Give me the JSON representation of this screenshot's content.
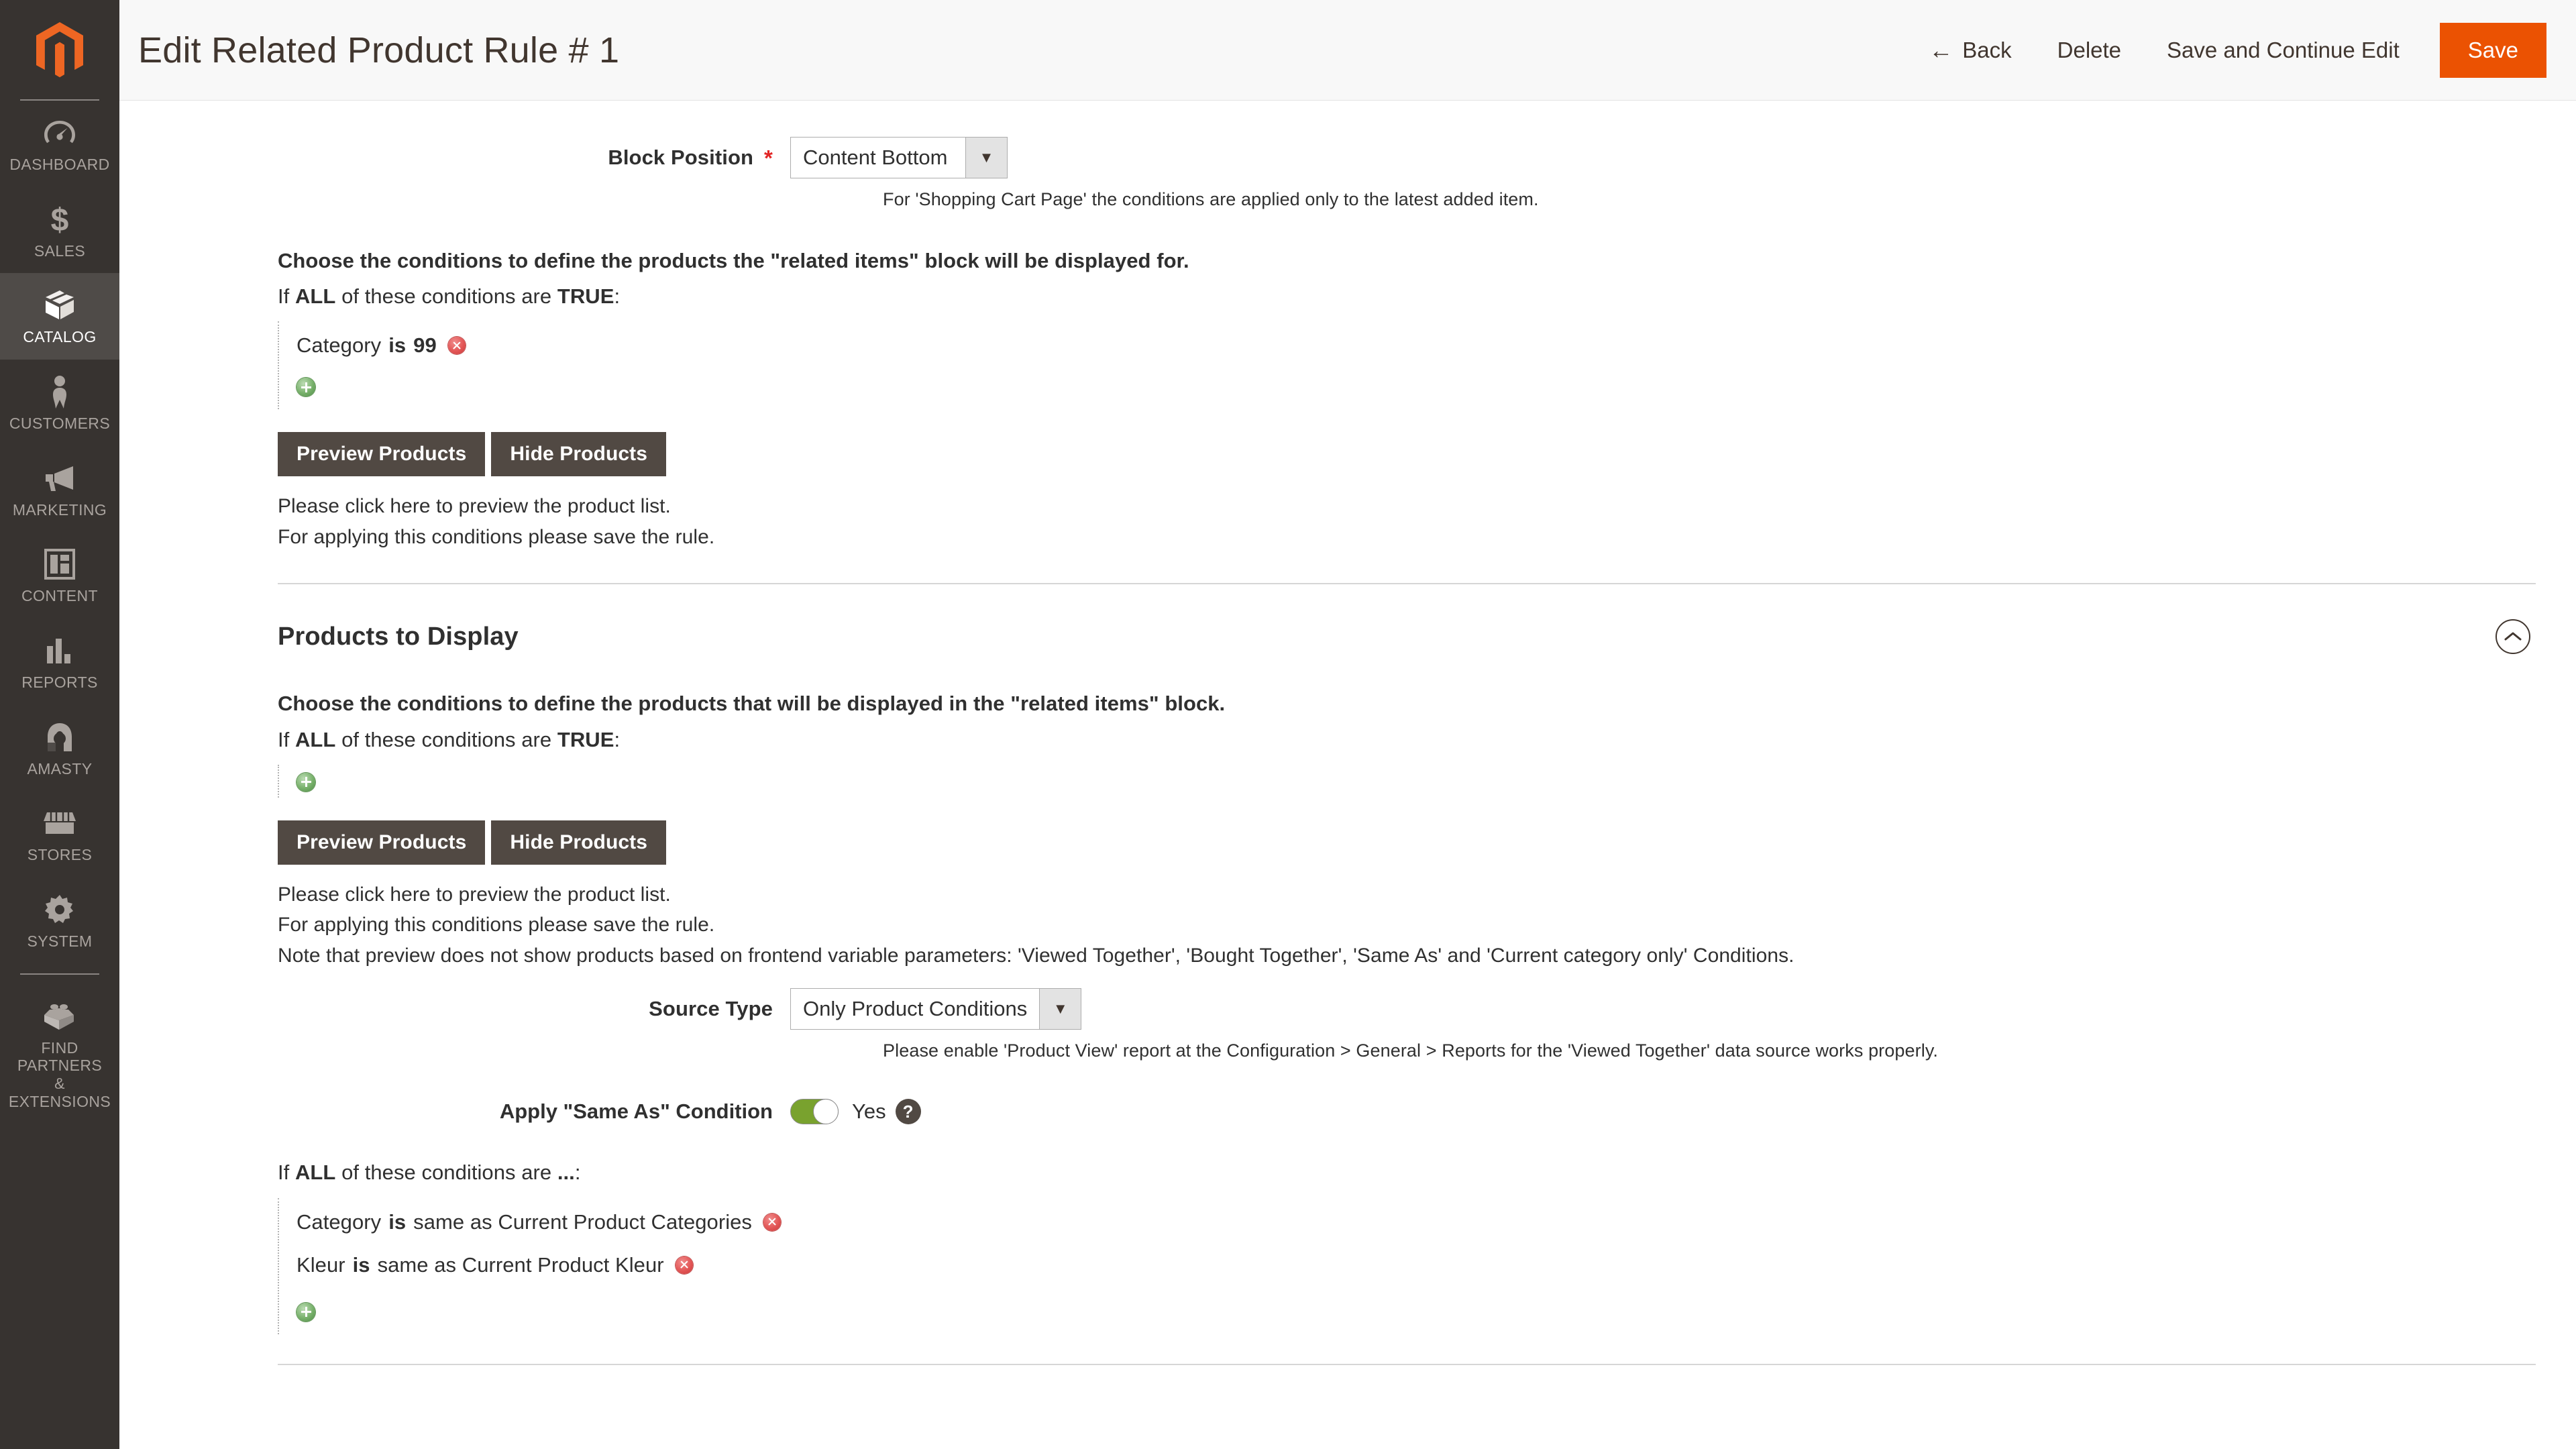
{
  "sidebar": {
    "logo_name": "magento-logo",
    "items": [
      {
        "label": "DASHBOARD",
        "icon": "dashboard-icon",
        "active": false
      },
      {
        "label": "SALES",
        "icon": "dollar-icon",
        "active": false
      },
      {
        "label": "CATALOG",
        "icon": "box-icon",
        "active": true
      },
      {
        "label": "CUSTOMERS",
        "icon": "person-icon",
        "active": false
      },
      {
        "label": "MARKETING",
        "icon": "megaphone-icon",
        "active": false
      },
      {
        "label": "CONTENT",
        "icon": "layout-icon",
        "active": false
      },
      {
        "label": "REPORTS",
        "icon": "bar-chart-icon",
        "active": false
      },
      {
        "label": "AMASTY",
        "icon": "amasty-icon",
        "active": false
      },
      {
        "label": "STORES",
        "icon": "storefront-icon",
        "active": false
      },
      {
        "label": "SYSTEM",
        "icon": "gear-icon",
        "active": false
      },
      {
        "label": "FIND PARTNERS\n& EXTENSIONS",
        "icon": "brick-icon",
        "active": false
      }
    ]
  },
  "header": {
    "title": "Edit Related Product Rule # 1",
    "back_label": "Back",
    "back_arrow": "←",
    "delete_label": "Delete",
    "save_continue_label": "Save and Continue Edit",
    "save_label": "Save",
    "accent_color": "#eb5202"
  },
  "block_position": {
    "label": "Block Position",
    "required_marker": "*",
    "value": "Content Bottom",
    "arrow": "▼",
    "hint": "For 'Shopping Cart Page' the conditions are applied only to the latest added item."
  },
  "display_conditions": {
    "intro": "Choose the conditions to define the products the \"related items\" block will be displayed for.",
    "if_prefix": "If",
    "aggregator": "ALL",
    "if_middle": "of these conditions are",
    "value_word": "TRUE",
    "colon": ":",
    "conditions": [
      {
        "attribute": "Category",
        "operator": "is",
        "value": "99"
      }
    ],
    "preview_label": "Preview Products",
    "hide_label": "Hide Products",
    "note1": "Please click here to preview the product list.",
    "note2": "For applying this conditions please save the rule."
  },
  "products_to_display": {
    "section_title": "Products to Display",
    "collapse_icon": "chevron-up-icon",
    "intro": "Choose the conditions to define the products that will be displayed in the \"related items\" block.",
    "if_prefix": "If",
    "aggregator": "ALL",
    "if_middle": "of these conditions are",
    "value_word": "TRUE",
    "colon": ":",
    "preview_label": "Preview Products",
    "hide_label": "Hide Products",
    "note1": "Please click here to preview the product list.",
    "note2": "For applying this conditions please save the rule.",
    "note3": "Note that preview does not show products based on frontend variable parameters: 'Viewed Together', 'Bought Together', 'Same As' and 'Current category only' Conditions.",
    "source_type": {
      "label": "Source Type",
      "value": "Only Product Conditions",
      "arrow": "▼",
      "hint": "Please enable 'Product View' report at the Configuration > General > Reports for the 'Viewed Together' data source works properly."
    },
    "same_as": {
      "label": "Apply \"Same As\" Condition",
      "toggle_state": "Yes",
      "toggle_on": true,
      "toggle_color": "#79a22e",
      "help_glyph": "?"
    },
    "same_as_conditions": {
      "if_prefix": "If",
      "aggregator": "ALL",
      "if_middle": "of these conditions are",
      "value_word": "...",
      "colon": ":",
      "conditions": [
        {
          "attribute": "Category",
          "operator": "is",
          "value": "same as Current Product Categories"
        },
        {
          "attribute": "Kleur",
          "operator": "is",
          "value": "same as Current Product Kleur"
        }
      ]
    }
  }
}
